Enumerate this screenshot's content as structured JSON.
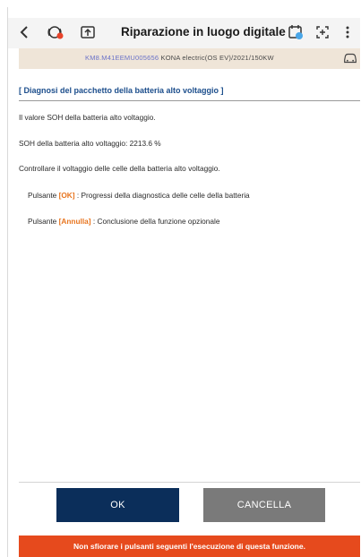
{
  "header": {
    "title": "Riparazione in luogo digitale"
  },
  "vehicle_bar": {
    "vin": "KM8.M41EEMU005656",
    "model_info": "KONA electric(OS EV)/2021/150KW"
  },
  "content": {
    "section_title": "[ Diagnosi del pacchetto della batteria alto voltaggio ]",
    "line1": "Il valore SOH della batteria alto voltaggio.",
    "line2": "SOH della batteria alto voltaggio: 2213.6 %",
    "line3": "Controllare il voltaggio delle celle della batteria alto voltaggio.",
    "ok_row": {
      "prefix": "Pulsante ",
      "button": "[OK]",
      "text": " : Progressi della diagnostica delle celle della batteria"
    },
    "cancel_row": {
      "prefix": "Pulsante ",
      "button": "[Annulla]",
      "text": " : Conclusione della funzione opzionale"
    }
  },
  "buttons": {
    "ok": "OK",
    "cancel": "CANCELLA"
  },
  "warning": "Non sfiorare i pulsanti seguenti l'esecuzione di questa funzione.",
  "colors": {
    "accent_orange": "#e8751f",
    "ok_button": "#0b2e5a",
    "cancel_button": "#7a7a7a",
    "warning_bar": "#e64a1d",
    "vehicle_bar": "#efe5d8",
    "section_title": "#1c4e8c"
  },
  "icons": [
    "back-icon",
    "warning-light-icon",
    "upload-icon",
    "calendar-icon",
    "capture-icon",
    "more-icon",
    "car-icon"
  ]
}
